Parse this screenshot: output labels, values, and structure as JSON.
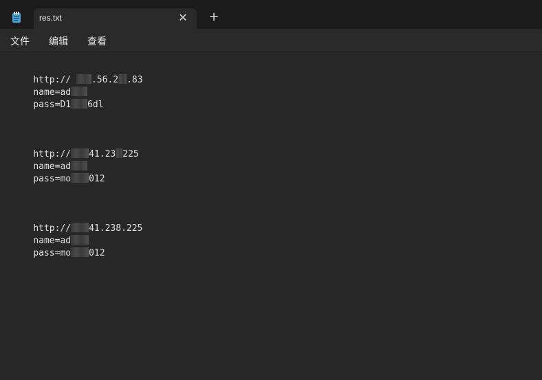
{
  "tab": {
    "title": "res.txt",
    "close_icon": "✕",
    "new_tab_icon": "+"
  },
  "menu": {
    "file": "文件",
    "edit": "编辑",
    "view": "查看"
  },
  "content": {
    "lines": [
      {
        "parts": [
          "http:// ",
          "",
          ".56.2",
          "",
          ".83"
        ]
      },
      {
        "parts": [
          "name=ad",
          ""
        ]
      },
      {
        "parts": [
          "pass=D1",
          "",
          "6dl"
        ]
      },
      {
        "parts": [
          "http://",
          "",
          "41.23",
          "",
          "225"
        ]
      },
      {
        "parts": [
          "name=ad",
          ""
        ]
      },
      {
        "parts": [
          "pass=mo",
          "",
          "012"
        ]
      },
      {
        "parts": [
          "http://",
          "",
          "41.238.225"
        ]
      },
      {
        "parts": [
          "name=ad",
          ""
        ]
      },
      {
        "parts": [
          "pass=mo",
          "",
          "012"
        ]
      }
    ]
  }
}
